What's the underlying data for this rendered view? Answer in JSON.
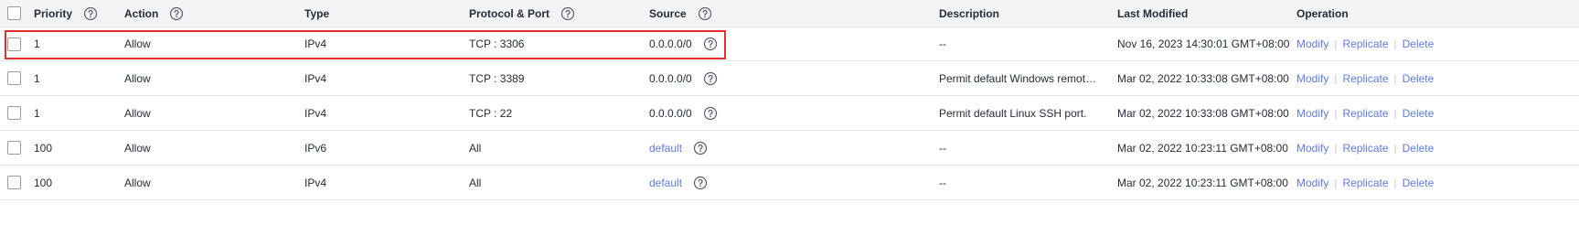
{
  "header": {
    "priority": "Priority",
    "action": "Action",
    "type": "Type",
    "protocol_port": "Protocol & Port",
    "source": "Source",
    "description": "Description",
    "last_modified": "Last Modified",
    "operation": "Operation"
  },
  "operations": {
    "modify": "Modify",
    "replicate": "Replicate",
    "delete": "Delete",
    "separator": "|"
  },
  "rows": [
    {
      "priority": "1",
      "action": "Allow",
      "type": "IPv4",
      "protocol_port": "TCP : 3306",
      "source": "0.0.0.0/0",
      "source_is_link": false,
      "description": "--",
      "last_modified": "Nov 16, 2023 14:30:01 GMT+08:00"
    },
    {
      "priority": "1",
      "action": "Allow",
      "type": "IPv4",
      "protocol_port": "TCP : 3389",
      "source": "0.0.0.0/0",
      "source_is_link": false,
      "description": "Permit default Windows remote d...",
      "last_modified": "Mar 02, 2022 10:33:08 GMT+08:00"
    },
    {
      "priority": "1",
      "action": "Allow",
      "type": "IPv4",
      "protocol_port": "TCP : 22",
      "source": "0.0.0.0/0",
      "source_is_link": false,
      "description": "Permit default Linux SSH port.",
      "last_modified": "Mar 02, 2022 10:33:08 GMT+08:00"
    },
    {
      "priority": "100",
      "action": "Allow",
      "type": "IPv6",
      "protocol_port": "All",
      "source": "default",
      "source_is_link": true,
      "description": "--",
      "last_modified": "Mar 02, 2022 10:23:11 GMT+08:00"
    },
    {
      "priority": "100",
      "action": "Allow",
      "type": "IPv4",
      "protocol_port": "All",
      "source": "default",
      "source_is_link": true,
      "description": "--",
      "last_modified": "Mar 02, 2022 10:23:11 GMT+08:00"
    }
  ],
  "colors": {
    "link": "#5e7ce0",
    "highlight": "#e52e2e",
    "header_bg": "#f3f4f6"
  },
  "highlighted_row_index": 0
}
